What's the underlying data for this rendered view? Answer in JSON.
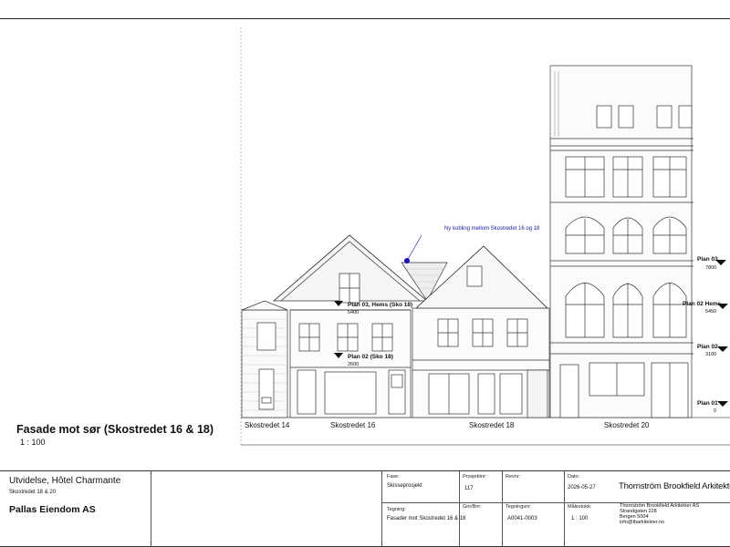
{
  "view": {
    "title": "Fasade mot sør (Skostredet 16 & 18)",
    "scale": "1 : 100"
  },
  "streets": [
    "Skostredet 14",
    "Skostredet 16",
    "Skostredet 18",
    "Skostredet 20"
  ],
  "levels_left": [
    {
      "name": "Plan 03, Hems (Sko 18)",
      "value": "5400"
    },
    {
      "name": "Plan 02 (Sko 18)",
      "value": "2600"
    }
  ],
  "levels_right": [
    {
      "name": "Plan 03",
      "value": "7800"
    },
    {
      "name": "Plan 02 Hems",
      "value": "5450"
    },
    {
      "name": "Plan 02",
      "value": "3100"
    },
    {
      "name": "Plan 01",
      "value": "0"
    }
  ],
  "annotation": "Ny kobling mellom Skostredet 16 og 18",
  "title_block": {
    "project": "Utvidelse, Hôtel Charmante",
    "project_sub": "Skostredet 18 & 20",
    "client": "Pallas Eiendom AS",
    "fase_label": "Fase:",
    "fase_value": "Skisseprosjekt",
    "prosjektnr_label": "Prosjektnr:",
    "prosjektnr_value": "117",
    "revnr_label": "Revnr:",
    "revnr_value": "",
    "dato_label": "Dato:",
    "dato_value": "2026-05-27",
    "tegning_label": "Tegning:",
    "tegning_value": "Fasader mot Skostredet 16 & 18",
    "gnr_label": "Gnr/Bnr:",
    "gnr_value": "",
    "tegningsnr_label": "Tegningsnr:",
    "tegningsnr_value": "A0041-0003",
    "malestokk_label": "Målestokk:",
    "malestokk_value": "1 : 100",
    "firm_name": "Thornström Brookfield Arkitekter",
    "firm_lines": [
      "Thornström Brookfield Arkitekter AS",
      "Strandgaten 228",
      "Bergen 5004",
      "info@tbarkitekter.no"
    ]
  },
  "colors": {
    "line": "#333333",
    "annotation": "#1a1aa0",
    "marker": "#1010d0"
  }
}
